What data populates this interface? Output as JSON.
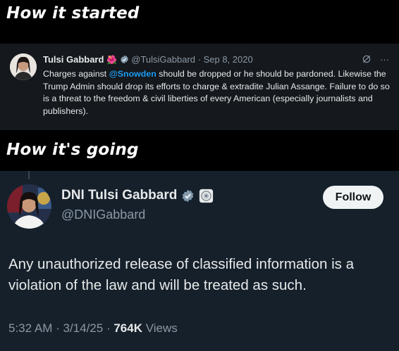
{
  "banners": {
    "top": "How it started",
    "middle": "How it's going"
  },
  "old_tweet": {
    "name": "Tulsi Gabbard",
    "emoji": "🌺",
    "handle": "@TulsiGabbard",
    "separator": " · ",
    "date": "Sep 8, 2020",
    "body_pre": "Charges against ",
    "mention": "@Snowden",
    "body_post": " should be dropped or he should be pardoned. Likewise the Trump Admin  should drop its efforts to charge & extradite Julian Assange. Failure to do so is a threat to the freedom & civil liberties of every American (especially journalists and publishers).",
    "more_icon_text": "···",
    "colors": {
      "mention": "#1d9bf0",
      "background": "#15181c"
    }
  },
  "new_tweet": {
    "name": "DNI Tulsi Gabbard",
    "handle": "@DNIGabbard",
    "follow_label": "Follow",
    "body": "Any unauthorized release of classified information is a violation of the law and will be treated as such.",
    "time": "5:32 AM",
    "date": "3/14/25",
    "views_count": "764K",
    "views_label": "Views",
    "separator": " · ",
    "colors": {
      "background": "#15202b",
      "verified": "#829aab"
    }
  }
}
